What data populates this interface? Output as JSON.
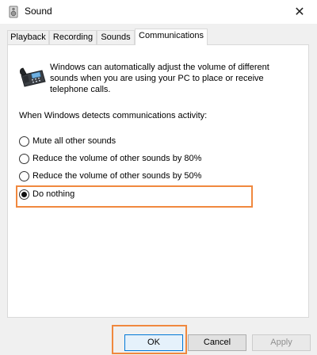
{
  "window": {
    "title": "Sound",
    "close_glyph": "✕"
  },
  "tabs": [
    {
      "label": "Playback",
      "active": false
    },
    {
      "label": "Recording",
      "active": false
    },
    {
      "label": "Sounds",
      "active": false
    },
    {
      "label": "Communications",
      "active": true
    }
  ],
  "communications": {
    "icon": "telephone-icon",
    "description": "Windows can automatically adjust the volume of different sounds when you are using your PC to place or receive telephone calls.",
    "detect_label": "When Windows detects communications activity:",
    "options": [
      {
        "label": "Mute all other sounds",
        "selected": false
      },
      {
        "label": "Reduce the volume of other sounds by 80%",
        "selected": false
      },
      {
        "label": "Reduce the volume of other sounds by 50%",
        "selected": false
      },
      {
        "label": "Do nothing",
        "selected": true
      }
    ]
  },
  "buttons": {
    "ok": "OK",
    "cancel": "Cancel",
    "apply": "Apply"
  },
  "colors": {
    "highlight": "#f0883e",
    "accent": "#0078d7"
  }
}
